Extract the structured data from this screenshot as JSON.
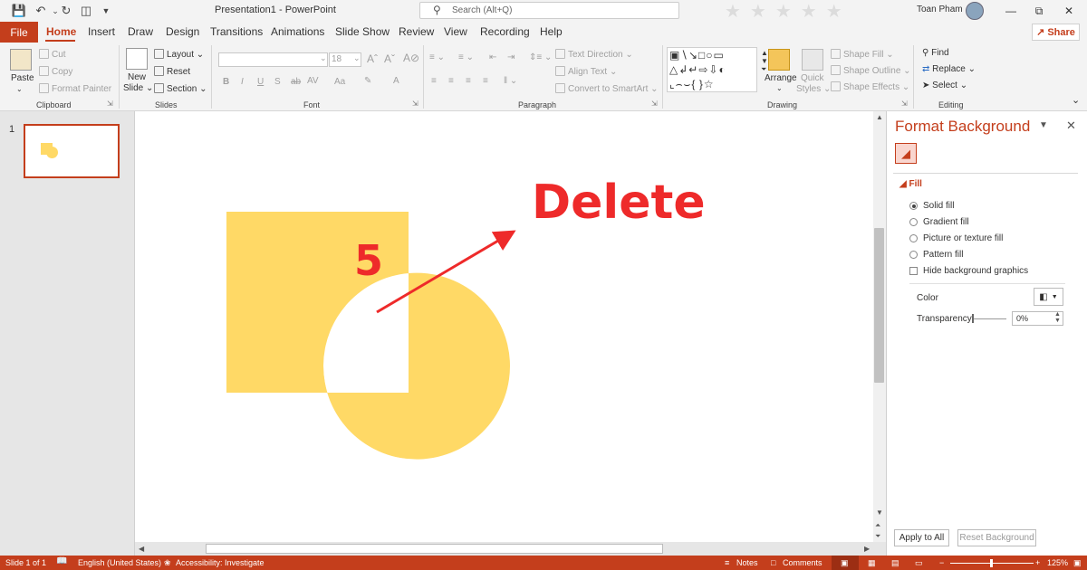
{
  "titlebar": {
    "document": "Presentation1",
    "separator": "-",
    "app": "PowerPoint",
    "search_placeholder": "Search (Alt+Q)",
    "user": "Toan Pham"
  },
  "tabs": {
    "file": "File",
    "items": [
      "Home",
      "Insert",
      "Draw",
      "Design",
      "Transitions",
      "Animations",
      "Slide Show",
      "Review",
      "View",
      "Recording",
      "Help"
    ],
    "share": "Share"
  },
  "ribbon": {
    "clipboard": {
      "paste": "Paste",
      "cut": "Cut",
      "copy": "Copy",
      "format_painter": "Format Painter",
      "label": "Clipboard"
    },
    "slides": {
      "new": "New",
      "slide": "Slide",
      "layout": "Layout",
      "reset": "Reset",
      "section": "Section",
      "label": "Slides"
    },
    "font": {
      "size": "18",
      "bold": "B",
      "italic": "I",
      "underline": "U",
      "strike": "S",
      "spacing": "AV",
      "case": "Aa",
      "label": "Font"
    },
    "paragraph": {
      "text_direction": "Text Direction",
      "align_text": "Align Text",
      "smartart": "Convert to SmartArt",
      "label": "Paragraph"
    },
    "drawing": {
      "arrange": "Arrange",
      "quick": "Quick",
      "styles": "Styles",
      "shape_fill": "Shape Fill",
      "shape_outline": "Shape Outline",
      "shape_effects": "Shape Effects",
      "label": "Drawing"
    },
    "editing": {
      "find": "Find",
      "replace": "Replace",
      "select": "Select",
      "label": "Editing"
    }
  },
  "thumbs": {
    "number": "1"
  },
  "slide": {
    "annotation_number": "5",
    "annotation_text": "Delete",
    "shape_color": "#ffd966",
    "annotation_color": "#ee2a2a"
  },
  "pane": {
    "title": "Format Background",
    "fill_header": "Fill",
    "options": [
      "Solid fill",
      "Gradient fill",
      "Picture or texture fill",
      "Pattern fill"
    ],
    "hide_bg": "Hide background graphics",
    "color_label": "Color",
    "transparency_label": "Transparency",
    "transparency_value": "0%",
    "apply_all": "Apply to All",
    "reset_bg": "Reset Background"
  },
  "status": {
    "slide": "Slide 1 of 1",
    "language": "English (United States)",
    "accessibility": "Accessibility: Investigate",
    "notes": "Notes",
    "comments": "Comments",
    "zoom": "125%"
  }
}
